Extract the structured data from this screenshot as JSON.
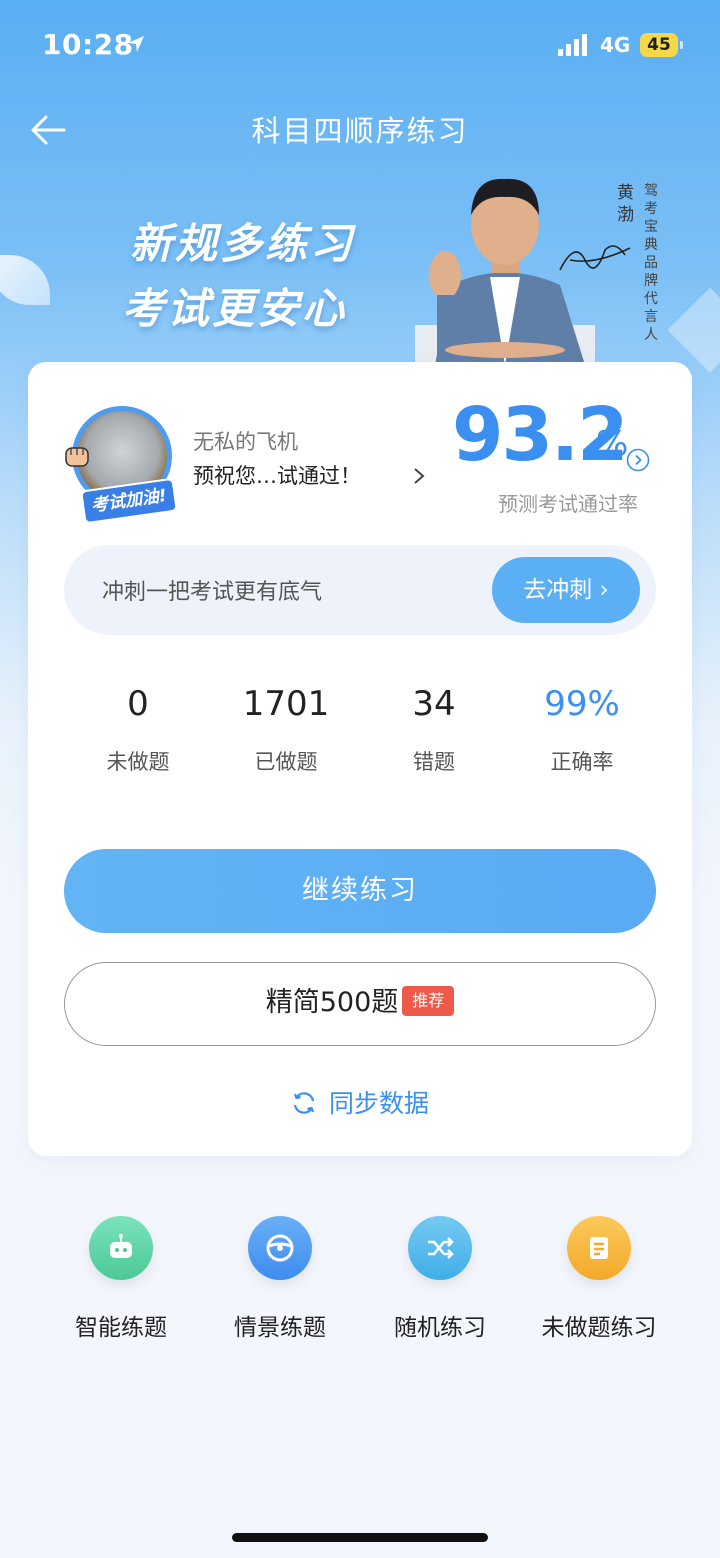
{
  "status_bar": {
    "time": "10:28",
    "network": "4G",
    "battery": "45"
  },
  "nav": {
    "title": "科目四顺序练习"
  },
  "banner": {
    "slogan_line1": "新规多练习",
    "slogan_line2": "考试更安心",
    "spokesperson_name": "黄渤",
    "spokesperson_title": "驾考宝典品牌代言人"
  },
  "profile": {
    "avatar_badge": "考试加油!",
    "username": "无私的飞机",
    "wish": "预祝您…试通过！",
    "pass_rate": "93.2",
    "pass_rate_unit": "%",
    "pass_rate_label": "预测考试通过率"
  },
  "sprint": {
    "text": "冲刺一把考试更有底气",
    "button": "去冲刺"
  },
  "stats": [
    {
      "value": "0",
      "label": "未做题"
    },
    {
      "value": "1701",
      "label": "已做题"
    },
    {
      "value": "34",
      "label": "错题"
    },
    {
      "value": "99%",
      "label": "正确率"
    }
  ],
  "actions": {
    "continue": "继续练习",
    "simplified": "精简500题",
    "recommend_tag": "推荐",
    "sync": "同步数据"
  },
  "modes": [
    {
      "label": "智能练题",
      "icon": "robot-icon",
      "color": "#5dd6a8"
    },
    {
      "label": "情景练题",
      "icon": "steering-wheel-icon",
      "color": "#4a9af2"
    },
    {
      "label": "随机练习",
      "icon": "shuffle-icon",
      "color": "#4fb8ee"
    },
    {
      "label": "未做题练习",
      "icon": "document-icon",
      "color": "#f7b73a"
    }
  ]
}
